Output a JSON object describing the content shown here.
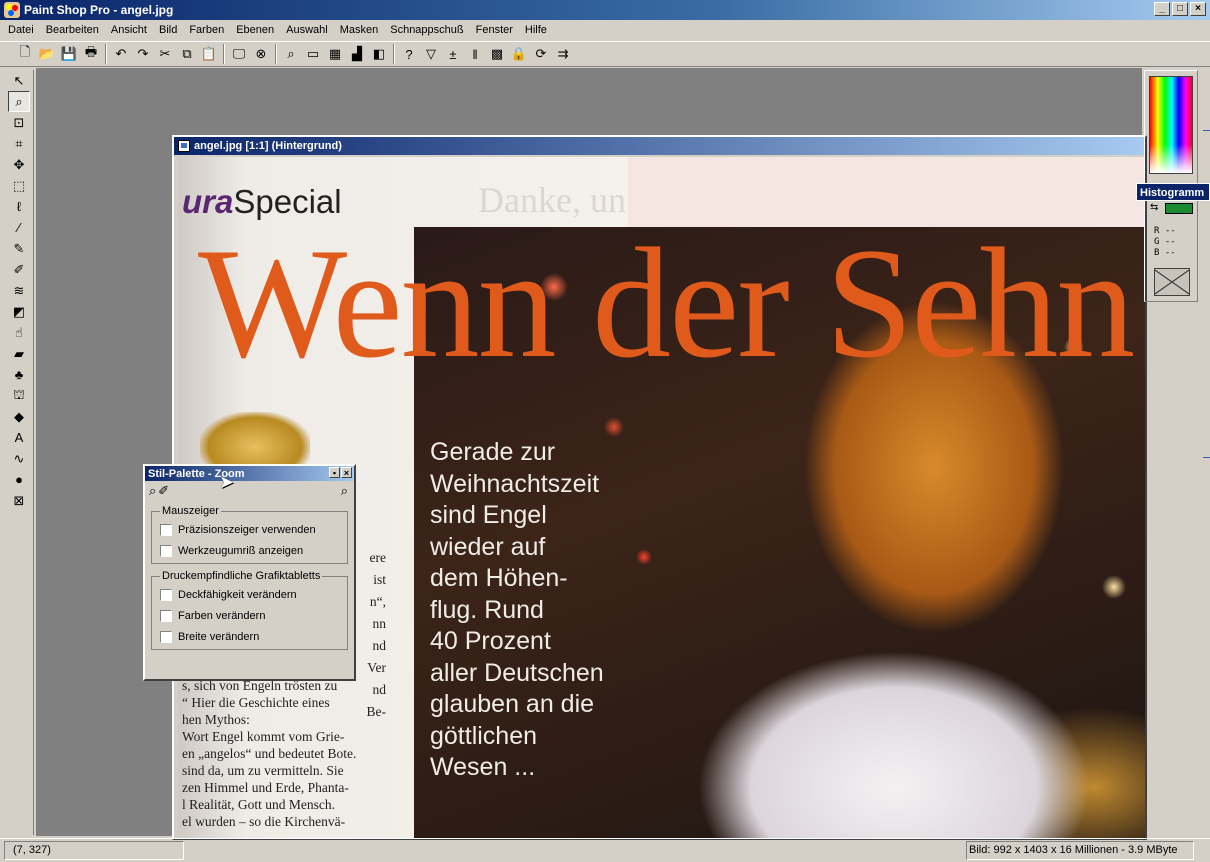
{
  "app": {
    "title": "Paint Shop Pro - angel.jpg",
    "window_buttons": [
      "_",
      "□",
      "×"
    ]
  },
  "menu": [
    "Datei",
    "Bearbeiten",
    "Ansicht",
    "Bild",
    "Farben",
    "Ebenen",
    "Auswahl",
    "Masken",
    "Schnappschuß",
    "Fenster",
    "Hilfe"
  ],
  "image_window": {
    "title": "angel.jpg [1:1] (Hintergrund)"
  },
  "image_content": {
    "brand": "ura",
    "special": "Special",
    "faded_header": "Danke, un",
    "headline": "Wenn der Sehn",
    "caption_lines": [
      "Gerade zur",
      "Weihnachtszeit",
      "sind Engel",
      "wieder auf",
      "dem Höhen-",
      "flug. Rund",
      "40 Prozent",
      "aller Deutschen",
      "glauben an die",
      "göttlichen",
      "Wesen ..."
    ],
    "article_fragments": [
      "ere",
      "ist",
      "n“,",
      "nn",
      "nd",
      "Ver",
      "nd",
      "Be-"
    ],
    "article_lines": [
      "s, sich von Engeln trösten zu",
      "“ Hier die Geschichte eines",
      "hen Mythos:",
      "Wort Engel kommt vom Grie-",
      "en „angelos“ und bedeutet Bote.",
      "sind da, um zu vermitteln. Sie",
      "zen Himmel und Erde, Phanta-",
      "l Realität, Gott und Mensch.",
      "el wurden – so die Kirchenvä-"
    ]
  },
  "stil_palette": {
    "title": "Stil-Palette - Zoom",
    "group1": {
      "legend": "Mauszeiger",
      "items": [
        "Präzisionszeiger verwenden",
        "Werkzeugumriß anzeigen"
      ]
    },
    "group2": {
      "legend": "Druckempfindliche Grafiktabletts",
      "items": [
        "Deckfähigkeit verändern",
        "Farben verändern",
        "Breite verändern"
      ]
    }
  },
  "color_panel": {
    "histogram_label": "Histogramm",
    "rgb_lines": [
      "R --",
      "G --",
      "B --"
    ],
    "swatch_color": "#1a8a30"
  },
  "status": {
    "coords": "(7, 327)",
    "image_info": "Bild:  992 x 1403 x 16 Millionen - 3.9 MByte"
  },
  "colors": {
    "accent_title": "#0a246a",
    "headline": "#e05a1c",
    "brand_purple": "#5a2572"
  }
}
